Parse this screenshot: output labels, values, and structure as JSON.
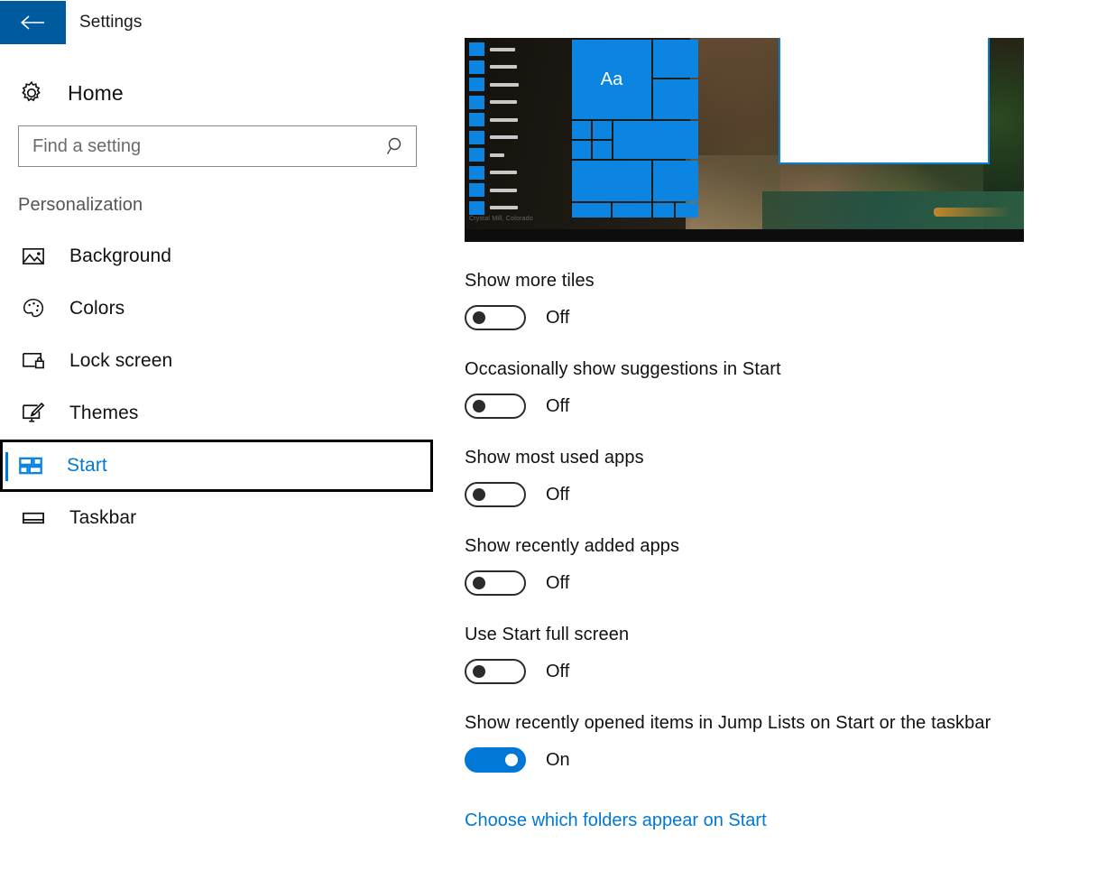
{
  "titlebar": {
    "back_label": "Back",
    "back_icon": "arrow-left-icon",
    "title": "Settings",
    "accent_color": "#005a9e"
  },
  "nav": {
    "home": {
      "label": "Home",
      "icon": "gear-icon"
    },
    "search": {
      "placeholder": "Find a setting",
      "value": "",
      "icon": "search-icon"
    },
    "section_label": "Personalization",
    "selected": "Start",
    "accent_color": "#0078d7",
    "items": [
      {
        "label": "Background",
        "icon": "picture-icon",
        "selected": false
      },
      {
        "label": "Colors",
        "icon": "palette-icon",
        "selected": false
      },
      {
        "label": "Lock screen",
        "icon": "monitor-lock-icon",
        "selected": false
      },
      {
        "label": "Themes",
        "icon": "monitor-brush-icon",
        "selected": false
      },
      {
        "label": "Start",
        "icon": "start-tiles-icon",
        "selected": true
      },
      {
        "label": "Taskbar",
        "icon": "taskbar-icon",
        "selected": false
      }
    ]
  },
  "preview": {
    "name": "start-menu-preview",
    "tile_text": "Aa",
    "wallpaper_caption": "Crystal Mill, Colorado",
    "tile_color": "#0c85e2",
    "app_list_count": 10
  },
  "settings": [
    {
      "label": "Show more tiles",
      "state": "Off",
      "on": false
    },
    {
      "label": "Occasionally show suggestions in Start",
      "state": "Off",
      "on": false
    },
    {
      "label": "Show most used apps",
      "state": "Off",
      "on": false
    },
    {
      "label": "Show recently added apps",
      "state": "Off",
      "on": false
    },
    {
      "label": "Use Start full screen",
      "state": "Off",
      "on": false
    },
    {
      "label": "Show recently opened items in Jump Lists on Start or the taskbar",
      "state": "On",
      "on": true
    }
  ],
  "link": {
    "label": "Choose which folders appear on Start",
    "color": "#0078d7"
  }
}
